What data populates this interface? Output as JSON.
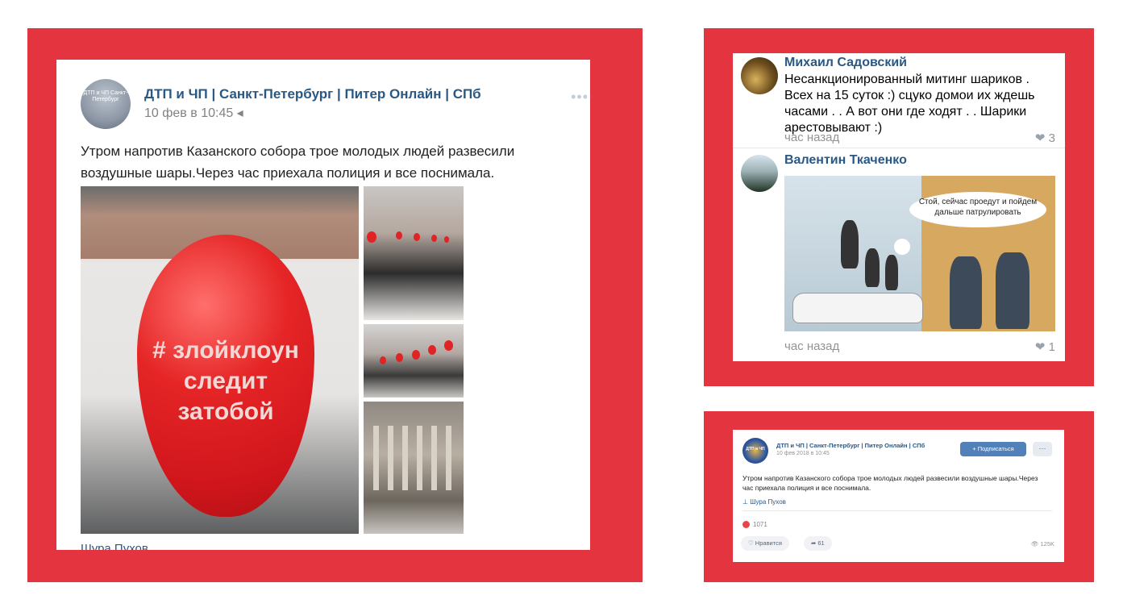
{
  "colors": {
    "frame_red": "#e4343f",
    "link_blue": "#2a5885",
    "button_blue": "#5181b8"
  },
  "post": {
    "author": "ДТП и ЧП | Санкт-Петербург | Питер Онлайн | СПб",
    "date": "10 фев в 10:45 ◂",
    "more": "•••",
    "avatar_text": "ДТП и ЧП Санкт-Петербург",
    "text": "Утром напротив Казанского собора трое молодых людей развесили воздушные шары.Через час приехала полиция и все поснимала.",
    "balloon_lines": [
      "# злойклоун",
      "следит",
      "затобой"
    ],
    "source_author": "Шура Пухов"
  },
  "comments": [
    {
      "name": "Михаил Садовский",
      "text": "Несанкционированный митинг шариков . Всех на 15 суток :) сцуко домои их ждешь часами . . А вот они где ходят . .  Шарики арестовывают :)",
      "time": "час назад",
      "likes": "3",
      "heart_icon": "❤"
    },
    {
      "name": "Валентин Ткаченко",
      "comic_bubble": "Стой, сейчас проедут и пойдем дальше патрулировать",
      "time": "час назад",
      "likes": "1",
      "heart_icon": "❤"
    }
  ],
  "embed": {
    "avatar_text": "ДТП и ЧП",
    "author": "ДТП и ЧП | Санкт-Петербург | Питер Онлайн | СПб",
    "date": "10 фев 2018 в 10:45",
    "subscribe": "+ Подписаться",
    "more": "···",
    "text": "Утром напротив Казанского собора трое молодых людей развесили воздушные шары.Через час приехала полиция и все поснимала.",
    "source_author": "⊥ Шура Пухов",
    "reactions": "1071",
    "like_label": "♡ Нравится",
    "share_label": "➦ 61",
    "views": "👁 125K"
  }
}
